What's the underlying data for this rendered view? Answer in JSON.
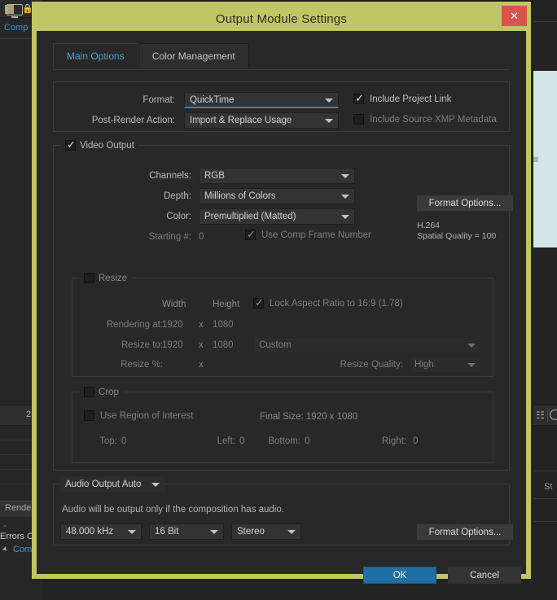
{
  "background": {
    "comp_link": "Comp",
    "comp_link2": "Comp",
    "monitor_number": "2",
    "render_label": "Render",
    "dash": "-",
    "errors_label": "Errors C",
    "status_label": "St",
    "lock_icon": "lock-icon"
  },
  "dialog": {
    "title": "Output Module Settings",
    "close_label": "✕",
    "tabs": [
      {
        "label": "Main Options",
        "active": true
      },
      {
        "label": "Color Management",
        "active": false
      }
    ],
    "top": {
      "format_label": "Format:",
      "format_value": "QuickTime",
      "post_render_label": "Post-Render Action:",
      "post_render_value": "Import & Replace Usage",
      "include_project_link_label": "Include Project Link",
      "include_project_link_checked": true,
      "include_xmp_label": "Include Source XMP Metadata",
      "include_xmp_checked": false
    },
    "video_output": {
      "legend": "Video Output",
      "legend_checked": true,
      "channels_label": "Channels:",
      "channels_value": "RGB",
      "depth_label": "Depth:",
      "depth_value": "Millions of Colors",
      "color_label": "Color:",
      "color_value": "Premultiplied (Matted)",
      "starting_label": "Starting #:",
      "starting_value": "0",
      "use_comp_frame_label": "Use Comp Frame Number",
      "use_comp_frame_checked": true,
      "format_options_label": "Format Options...",
      "codec_note_line1": "H.264",
      "codec_note_line2": "Spatial Quality = 100"
    },
    "resize": {
      "legend": "Resize",
      "legend_checked": false,
      "width_header": "Width",
      "height_header": "Height",
      "lock_aspect_label": "Lock Aspect Ratio to 16:9 (1.78)",
      "lock_aspect_checked": true,
      "rendering_at_label": "Rendering at:",
      "rendering_width": "1920",
      "rendering_height": "1080",
      "resize_to_label": "Resize to:",
      "resize_width": "1920",
      "resize_height": "1080",
      "preset_value": "Custom",
      "resize_pct_label": "Resize %:",
      "resize_pct_width": "",
      "resize_pct_height": "",
      "quality_label": "Resize Quality:",
      "quality_value": "High",
      "x_sep": "x"
    },
    "crop": {
      "legend": "Crop",
      "legend_checked": false,
      "use_roi_label": "Use Region of Interest",
      "use_roi_checked": false,
      "final_size_label": "Final Size: 1920 x 1080",
      "top_label": "Top:",
      "top_value": "0",
      "left_label": "Left:",
      "left_value": "0",
      "bottom_label": "Bottom:",
      "bottom_value": "0",
      "right_label": "Right:",
      "right_value": "0"
    },
    "audio": {
      "legend": "Audio Output Auto",
      "description": "Audio will be output only if the composition has audio.",
      "sample_rate": "48.000 kHz",
      "bit_depth": "16 Bit",
      "channels": "Stereo",
      "format_options_label": "Format Options..."
    },
    "footer": {
      "ok_label": "OK",
      "cancel_label": "Cancel"
    }
  },
  "colors": {
    "dialog_border": "#c2c565",
    "close_button": "#d9534f",
    "accent_blue": "#4a9fd4",
    "primary_button": "#1f6fa5",
    "panel_bg": "#282828"
  }
}
